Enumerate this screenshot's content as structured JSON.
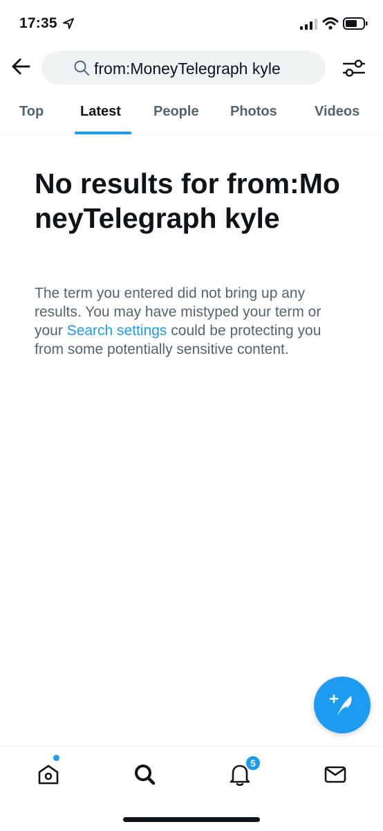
{
  "status_bar": {
    "time": "17:35"
  },
  "search": {
    "query": "from:MoneyTelegraph kyle"
  },
  "tabs": [
    {
      "label": "Top"
    },
    {
      "label": "Latest"
    },
    {
      "label": "People"
    },
    {
      "label": "Photos"
    },
    {
      "label": "Videos"
    }
  ],
  "active_tab": "Latest",
  "empty_state": {
    "title": "No results for from:MoneyTelegraph kyle",
    "body_before": "The term you entered did not bring up any results. You may have mistyped your term or your ",
    "link": "Search settings",
    "body_after": " could be protecting you from some potentially sensitive content."
  },
  "bottom_nav": {
    "notifications_badge": "5",
    "items": [
      "home-icon",
      "search-icon",
      "bell-icon",
      "mail-icon"
    ]
  },
  "colors": {
    "accent": "#1d9bf0",
    "text_primary": "#0f1419",
    "text_secondary": "#536471",
    "search_bg": "#eff3f4"
  }
}
